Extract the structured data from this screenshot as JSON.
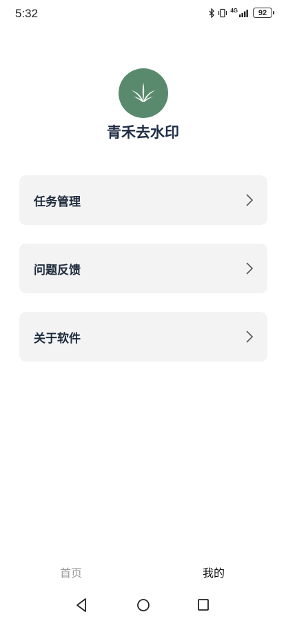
{
  "status_bar": {
    "time": "5:32",
    "network": "4G",
    "battery": "92"
  },
  "app": {
    "name": "青禾去水印",
    "logo_color": "#5a8a6e"
  },
  "menu": {
    "items": [
      {
        "label": "任务管理"
      },
      {
        "label": "问题反馈"
      },
      {
        "label": "关于软件"
      }
    ]
  },
  "tabs": {
    "home": "首页",
    "mine": "我的",
    "active": "mine"
  },
  "icons": {
    "chevron": "chevron-right-icon",
    "nav_back": "back-triangle-icon",
    "nav_home": "home-circle-icon",
    "nav_recents": "recents-square-icon"
  }
}
